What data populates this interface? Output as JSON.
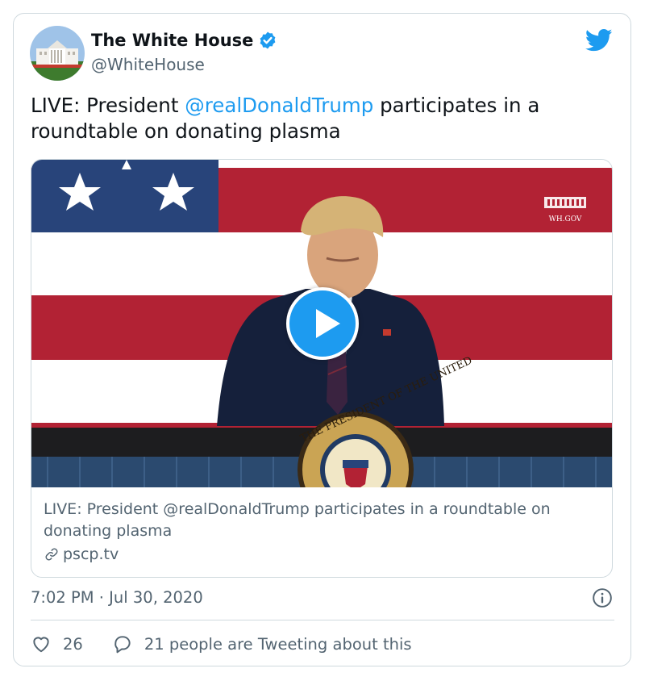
{
  "account": {
    "name": "The White House",
    "handle": "@WhiteHouse",
    "verified_icon": "verified-badge-icon",
    "avatar_icon": "white-house-avatar"
  },
  "tweet": {
    "text_prefix": "LIVE: President ",
    "mention": "@realDonaldTrump",
    "text_suffix": " participates in a roundtable on donating plasma",
    "timestamp": "7:02 PM · Jul 30, 2020"
  },
  "card": {
    "title": "LIVE: President @realDonaldTrump participates in a roundtable on donating plasma",
    "domain": "pscp.tv",
    "watermark": "WH.GOV",
    "seal_text": "THE PRESIDENT OF THE UNITED"
  },
  "engagement": {
    "likes": "26",
    "conversation": "21 people are Tweeting about this"
  },
  "colors": {
    "accent": "#1d9bf0",
    "secondary_text": "#536471",
    "border": "#cfd9de",
    "flag_red": "#b22234",
    "flag_blue": "#28447a"
  }
}
